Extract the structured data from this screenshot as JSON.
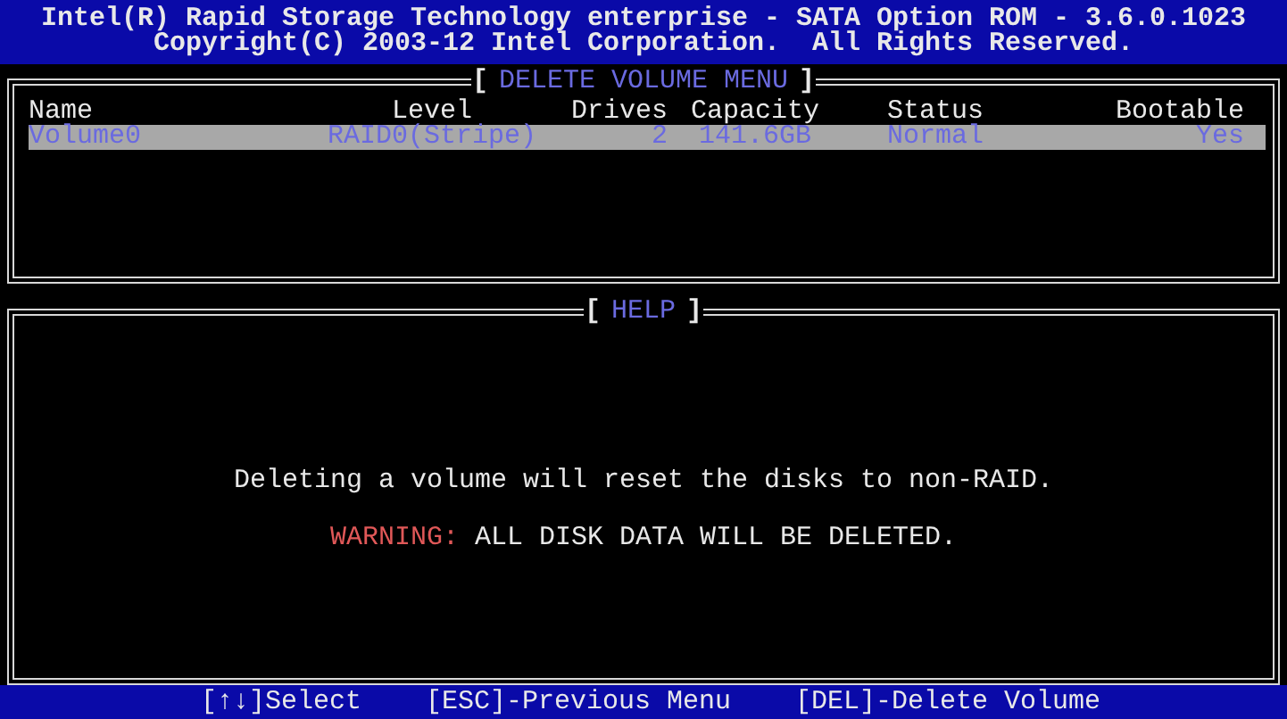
{
  "header": {
    "title": "Intel(R) Rapid Storage Technology enterprise - SATA Option ROM - 3.6.0.1023",
    "copyright": "Copyright(C) 2003-12 Intel Corporation.  All Rights Reserved."
  },
  "volume_panel": {
    "title_open": "[",
    "title": "DELETE VOLUME MENU",
    "title_close": "]",
    "columns": [
      "Name",
      "Level",
      "Drives",
      "Capacity",
      "Status",
      "Bootable"
    ],
    "rows": [
      {
        "selected": true,
        "cells": [
          "Volume0",
          "RAID0(Stripe)",
          "2",
          "141.6GB",
          "Normal",
          "Yes"
        ]
      }
    ]
  },
  "help_panel": {
    "title_open": "[",
    "title": "HELP",
    "title_close": "]",
    "message": "Deleting a volume will reset the disks to non-RAID.",
    "warning_label": "WARNING:",
    "warning_text": "ALL DISK DATA WILL BE DELETED."
  },
  "footer": [
    "[↑↓]Select",
    "[ESC]-Previous Menu",
    "[DEL]-Delete Volume"
  ]
}
